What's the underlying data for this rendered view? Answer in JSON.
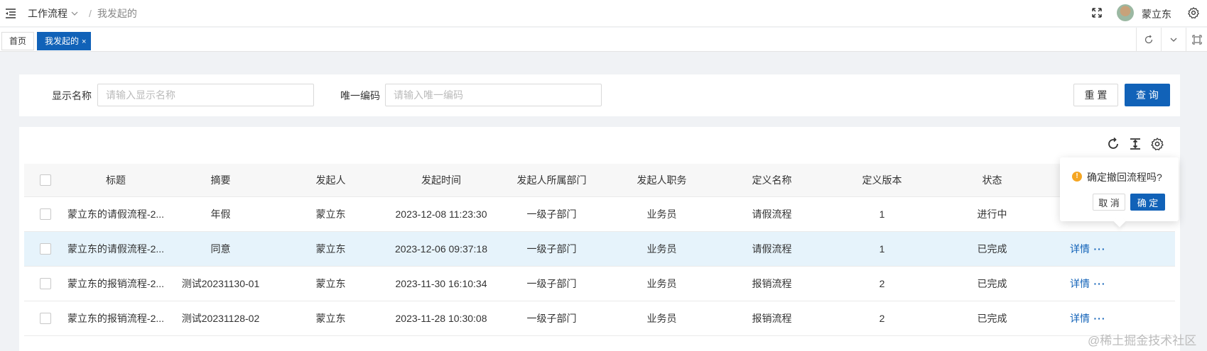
{
  "breadcrumb": {
    "first": "工作流程",
    "current": "我发起的"
  },
  "user": {
    "name": "蒙立东"
  },
  "tabs": [
    {
      "label": "首页"
    },
    {
      "label": "我发起的",
      "close": "×"
    }
  ],
  "search": {
    "name_label": "显示名称",
    "name_placeholder": "请输入显示名称",
    "code_label": "唯一编码",
    "code_placeholder": "请输入唯一编码",
    "reset_label": "重 置",
    "query_label": "查 询"
  },
  "table": {
    "columns": [
      "标题",
      "摘要",
      "发起人",
      "发起时间",
      "发起人所属部门",
      "发起人职务",
      "定义名称",
      "定义版本",
      "状态"
    ],
    "detail_label": "详情",
    "more_label": "···",
    "rows": [
      [
        "蒙立东的请假流程-2...",
        "年假",
        "蒙立东",
        "2023-12-08 11:23:30",
        "一级子部门",
        "业务员",
        "请假流程",
        "1",
        "进行中"
      ],
      [
        "蒙立东的请假流程-2...",
        "同意",
        "蒙立东",
        "2023-12-06 09:37:18",
        "一级子部门",
        "业务员",
        "请假流程",
        "1",
        "已完成"
      ],
      [
        "蒙立东的报销流程-2...",
        "测试20231130-01",
        "蒙立东",
        "2023-11-30 16:10:34",
        "一级子部门",
        "业务员",
        "报销流程",
        "2",
        "已完成"
      ],
      [
        "蒙立东的报销流程-2...",
        "测试20231128-02",
        "蒙立东",
        "2023-11-28 10:30:08",
        "一级子部门",
        "业务员",
        "报销流程",
        "2",
        "已完成"
      ]
    ]
  },
  "popconfirm": {
    "icon": "!",
    "message": "确定撤回流程吗?",
    "cancel_label": "取 消",
    "ok_label": "确 定"
  },
  "watermark": "@稀土掘金技术社区",
  "colors": {
    "primary": "#1162b8",
    "hover_row": "#e6f3fb",
    "warning": "#f5a623"
  }
}
